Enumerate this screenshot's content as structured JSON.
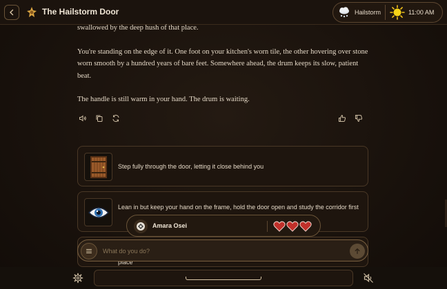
{
  "header": {
    "title": "The Hailstorm Door",
    "weather": {
      "label": "Hailstorm",
      "icon": "hail-cloud-icon"
    },
    "time": {
      "label": "11:00 AM",
      "icon": "sun-icon"
    }
  },
  "story": {
    "cut_line": "swallowed by the deep hush of that place.",
    "paragraph_1": "You're standing on the edge of it. One foot on your kitchen's worn tile, the other hovering over stone worn smooth by a hundred years of bare feet. Somewhere ahead, the drum keeps its slow, patient beat.",
    "paragraph_2": "The handle is still warm in your hand. The drum is waiting."
  },
  "message_actions": {
    "left": [
      "speaker-icon",
      "copy-icon",
      "regenerate-icon"
    ],
    "right": [
      "thumbs-up-icon",
      "thumbs-down-icon"
    ]
  },
  "choices": [
    {
      "text": "Step fully through the door, letting it close behind you",
      "icon": "door-icon"
    },
    {
      "text": "Lean in but keep your hand on the frame, hold the door open and study the corridor first",
      "icon": "eye-icon"
    },
    {
      "text": "place",
      "icon": ""
    }
  ],
  "character": {
    "name": "Amara Osei",
    "hearts": 3,
    "heart_color": "#c0302a"
  },
  "input": {
    "placeholder": "What do you do?",
    "value": ""
  },
  "colors": {
    "background": "#17100b",
    "accent": "#7a6040",
    "text": "#e4d8c6"
  }
}
